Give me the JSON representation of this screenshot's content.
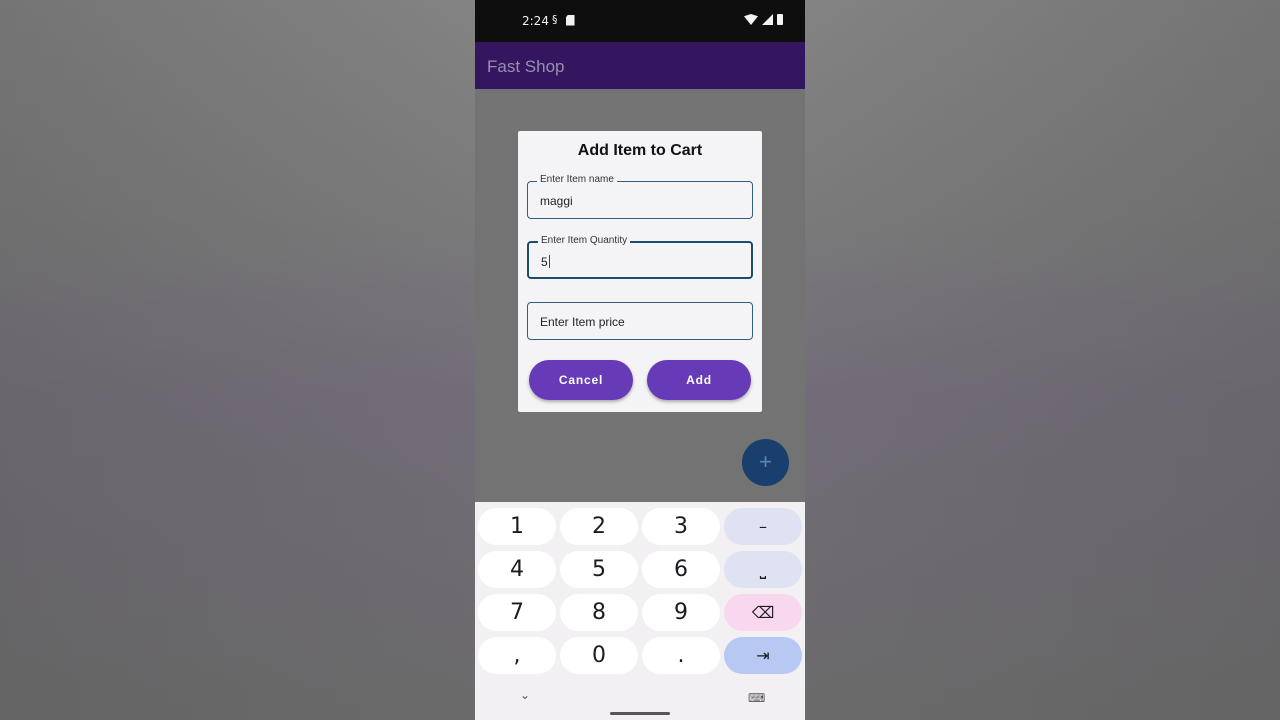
{
  "status_bar": {
    "time": "2:24",
    "icons": [
      "sync-icon",
      "sim-card-icon",
      "wifi-icon",
      "signal-icon",
      "battery-icon"
    ]
  },
  "app_bar": {
    "title": "Fast Shop"
  },
  "dialog": {
    "title": "Add Item to Cart",
    "fields": {
      "name": {
        "label": "Enter Item name",
        "value": "maggi"
      },
      "quantity": {
        "label": "Enter Item Quantity",
        "value": "5"
      },
      "price": {
        "placeholder": "Enter Item price"
      }
    },
    "buttons": {
      "cancel": "Cancel",
      "add": "Add"
    }
  },
  "fab": {
    "symbol": "+"
  },
  "keyboard": {
    "keys": {
      "k1": "1",
      "k2": "2",
      "k3": "3",
      "minus": "–",
      "k4": "4",
      "k5": "5",
      "k6": "6",
      "space": "⎵",
      "k7": "7",
      "k8": "8",
      "k9": "9",
      "backspace": "⌫",
      "comma": ",",
      "k0": "0",
      "period": ".",
      "next": "⇥"
    },
    "hide_icon": "⌄",
    "switch_icon": "⌨"
  },
  "colors": {
    "accent": "#673ab7",
    "app_bar": "#33165f",
    "fab": "#183f6e",
    "field_border": "#2f5f7c"
  }
}
